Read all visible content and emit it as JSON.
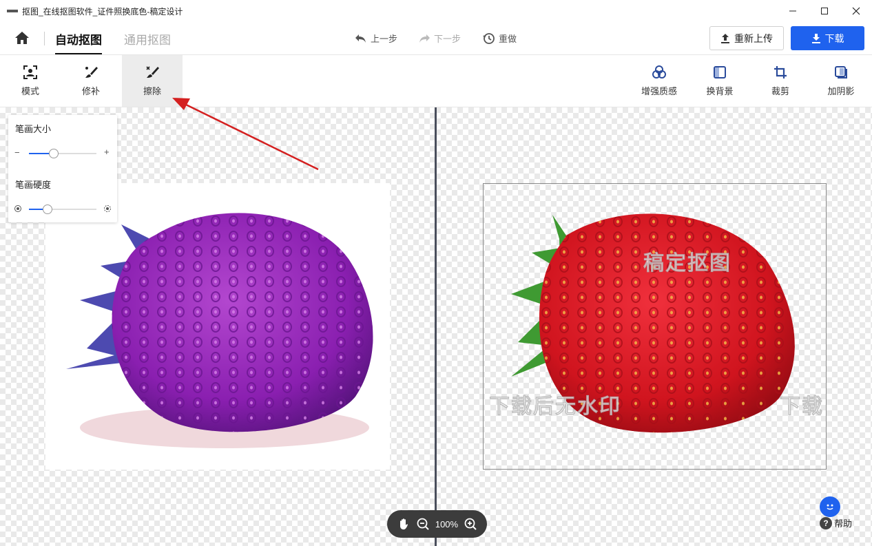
{
  "window": {
    "title": "抠图_在线抠图软件_证件照换底色-稿定设计",
    "minimize_label": "—",
    "maximize_label": "☐",
    "close_label": "✕"
  },
  "header": {
    "tabs": [
      "自动抠图",
      "通用抠图"
    ],
    "undo_label": "上一步",
    "redo_label": "下一步",
    "reset_label": "重做",
    "reupload_label": "重新上传",
    "download_label": "下载"
  },
  "toolbar": {
    "left_tools": [
      "模式",
      "修补",
      "擦除"
    ],
    "selected_tool": "擦除",
    "right_tools": [
      "增强质感",
      "换背景",
      "裁剪",
      "加阴影"
    ]
  },
  "brush_panel": {
    "size_label": "笔画大小",
    "size_value": 0.37,
    "size_minus": "−",
    "size_plus": "+",
    "hardness_label": "笔画硬度",
    "hardness_value": 0.28
  },
  "preview": {
    "watermarks": [
      "稿定抠图",
      "下载后无水印",
      "下载"
    ]
  },
  "zoom": {
    "level": "100%"
  },
  "help": {
    "label": "帮助"
  },
  "colors": {
    "accent": "#1f62ee",
    "arrow": "#d42020"
  }
}
